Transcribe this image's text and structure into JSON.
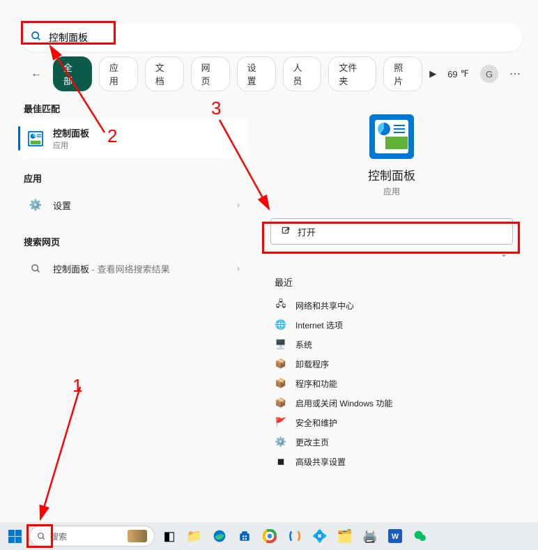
{
  "search": {
    "value": "控制面板"
  },
  "tabs": [
    "全部",
    "应用",
    "文档",
    "网页",
    "设置",
    "人员",
    "文件夹",
    "照片"
  ],
  "weather": "69",
  "avatar": "G",
  "left": {
    "best_match": "最佳匹配",
    "result": {
      "title": "控制面板",
      "sub": "应用"
    },
    "apps_header": "应用",
    "settings": "设置",
    "web_header": "搜索网页",
    "web_item": {
      "title": "控制面板",
      "sub": " - 查看网络搜索结果"
    }
  },
  "preview": {
    "title": "控制面板",
    "sub": "应用",
    "open": "打开"
  },
  "recent": {
    "header": "最近",
    "items": [
      "网络和共享中心",
      "Internet 选项",
      "系统",
      "卸载程序",
      "程序和功能",
      "启用或关闭 Windows 功能",
      "安全和维护",
      "更改主页",
      "高级共享设置"
    ]
  },
  "taskbar": {
    "search_placeholder": "搜索"
  },
  "anno": {
    "n1": "1",
    "n2": "2",
    "n3": "3"
  }
}
